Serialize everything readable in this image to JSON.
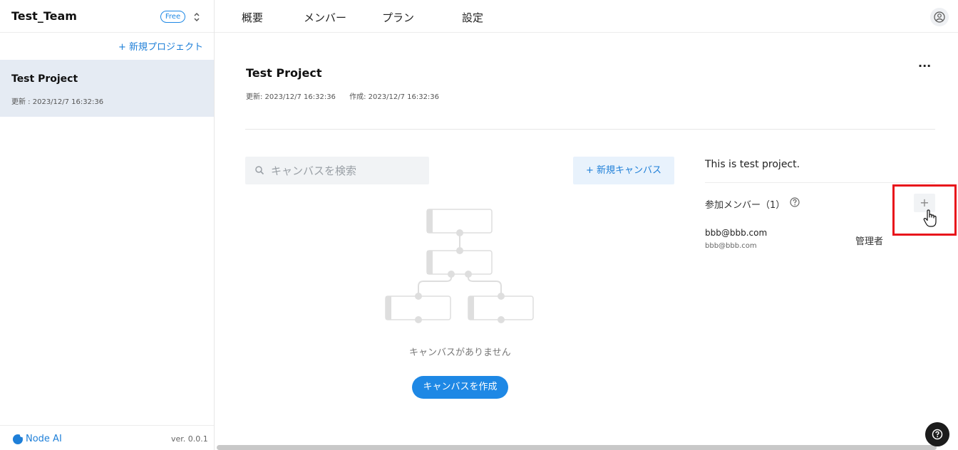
{
  "sidebar": {
    "team_name": "Test_Team",
    "plan_badge": "Free",
    "new_project_label": "+ 新規プロジェクト",
    "projects": [
      {
        "name": "Test Project",
        "updated": "更新 : 2023/12/7 16:32:36"
      }
    ],
    "logo_text": "Node AI",
    "version": "ver. 0.0.1"
  },
  "topnav": {
    "tabs": [
      "概要",
      "メンバー",
      "プラン",
      "設定"
    ]
  },
  "project": {
    "title": "Test Project",
    "updated": "更新: 2023/12/7 16:32:36",
    "created": "作成: 2023/12/7 16:32:36",
    "more_label": "···"
  },
  "canvas": {
    "search_placeholder": "キャンバスを検索",
    "new_canvas_label": "+ 新規キャンバス",
    "empty_text": "キャンバスがありません",
    "create_label": "キャンバスを作成"
  },
  "panel": {
    "description": "This is test project.",
    "members_label": "参加メンバー（1）",
    "add_label": "+",
    "members": [
      {
        "name": "bbb@bbb.com",
        "email": "bbb@bbb.com",
        "role": "管理者"
      }
    ]
  },
  "colors": {
    "accent": "#1e88e5",
    "highlight": "#e8141b",
    "selected_bg": "#e5ebf3"
  }
}
